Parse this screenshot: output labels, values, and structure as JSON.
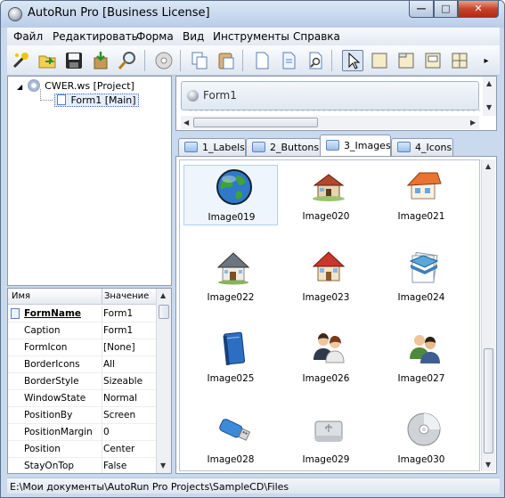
{
  "window": {
    "title": "AutoRun Pro [Business License]",
    "buttons": {
      "minimize": "—",
      "maximize": "□",
      "close": "✕"
    }
  },
  "menu": [
    "Файл",
    "Редактировать",
    "Форма",
    "Вид",
    "Инструменты",
    "Справка"
  ],
  "toolbar": {
    "icons": [
      "wizard-icon",
      "open-icon",
      "save-icon",
      "build-icon",
      "find-icon",
      "disc-icon",
      "copy-icon",
      "paste-icon",
      "new-page-icon",
      "page-icon",
      "preview-icon",
      "pointer-icon",
      "frame-icon",
      "frame-tab-icon",
      "frame-panel-icon",
      "grid-icon",
      "more-arrow-icon"
    ],
    "pressed": "pointer-icon"
  },
  "tree": {
    "root": "CWER.ws [Project]",
    "child": "Form1 [Main]"
  },
  "properties": {
    "header_name": "Имя",
    "header_value": "Значение",
    "rows": [
      {
        "name": "FormName",
        "value": "Form1"
      },
      {
        "name": "Caption",
        "value": "Form1"
      },
      {
        "name": "FormIcon",
        "value": "[None]"
      },
      {
        "name": "BorderIcons",
        "value": "All"
      },
      {
        "name": "BorderStyle",
        "value": "Sizeable"
      },
      {
        "name": "WindowState",
        "value": "Normal"
      },
      {
        "name": "PositionBy",
        "value": "Screen"
      },
      {
        "name": "PositionMargin",
        "value": "0"
      },
      {
        "name": "Position",
        "value": "Center"
      },
      {
        "name": "StayOnTop",
        "value": "False"
      }
    ],
    "selected_row": 0
  },
  "form_designer": {
    "caption": "Form1"
  },
  "tabs": [
    {
      "label": "1_Labels"
    },
    {
      "label": "2_Buttons"
    },
    {
      "label": "3_Images"
    },
    {
      "label": "4_Icons"
    }
  ],
  "active_tab": 2,
  "images": [
    {
      "label": "Image019",
      "icon": "globe-icon"
    },
    {
      "label": "Image020",
      "icon": "small-house-icon"
    },
    {
      "label": "Image021",
      "icon": "orange-house-icon"
    },
    {
      "label": "Image022",
      "icon": "grey-house-icon"
    },
    {
      "label": "Image023",
      "icon": "red-roof-house-icon"
    },
    {
      "label": "Image024",
      "icon": "stacked-documents-icon"
    },
    {
      "label": "Image025",
      "icon": "blue-book-icon"
    },
    {
      "label": "Image026",
      "icon": "two-users-icon"
    },
    {
      "label": "Image027",
      "icon": "user-group-icon"
    },
    {
      "label": "Image028",
      "icon": "usb-drive-icon"
    },
    {
      "label": "Image029",
      "icon": "usb-hard-drive-icon"
    },
    {
      "label": "Image030",
      "icon": "cd-disc-icon"
    }
  ],
  "selected_image": 0,
  "status": {
    "path": "E:\\Мои документы\\AutoRun Pro Projects\\SampleCD\\Files"
  }
}
